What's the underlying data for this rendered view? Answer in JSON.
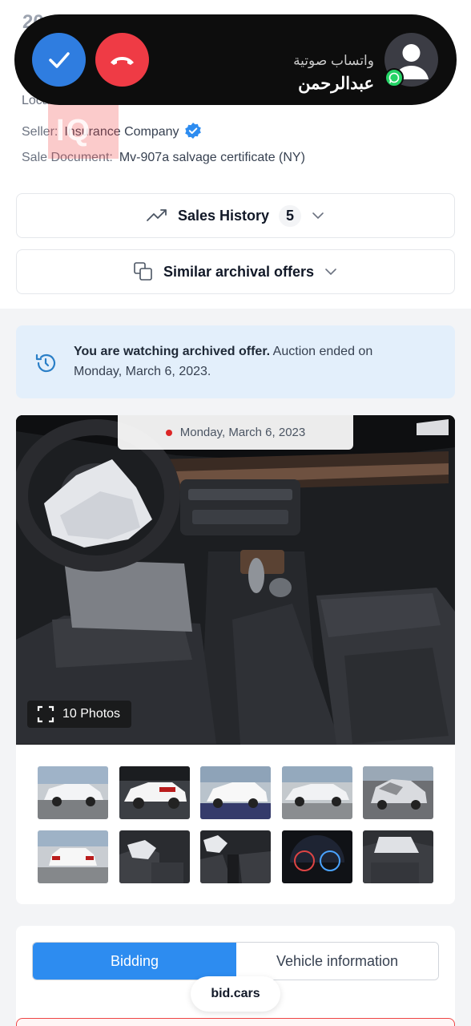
{
  "page": {
    "title_peek": "20",
    "location_label": "Location:",
    "seller_label": "Seller:",
    "seller_value": "Insurance Company",
    "sale_document_label": "Sale Document:",
    "sale_document_value": "Mv-907a salvage certificate (NY)"
  },
  "watermark": {
    "text": "IQ"
  },
  "incoming_call": {
    "caller_subtitle": "واتساب صوتية",
    "caller_name": "عبدالرحمن",
    "accept_icon": "checkmark-icon",
    "decline_icon": "phone-hangup-icon",
    "colors": {
      "bar": "#0d0d0d",
      "accept": "#2f7de0",
      "decline": "#ef3b45",
      "whatsapp": "#25d366"
    }
  },
  "sales_history": {
    "label": "Sales History",
    "count": "5",
    "icon": "trending-up-icon"
  },
  "similar_offers": {
    "label": "Similar archival offers",
    "icon": "copy-icon"
  },
  "notice": {
    "bold": "You are watching archived offer.",
    "text": " Auction ended on Monday, March 6, 2023.",
    "icon": "history-icon",
    "background": "#e3effb"
  },
  "gallery": {
    "date": "Monday, March 6, 2023",
    "photos_label": "10 Photos",
    "photos_icon": "fullscreen-icon",
    "thumbnails": [
      "exterior-front-left",
      "exterior-rear-left",
      "exterior-rear-right",
      "exterior-side-right",
      "exterior-front-damage",
      "exterior-rear",
      "interior-airbag-driver",
      "interior-front-seats",
      "instrument-cluster",
      "interior-rear-seats"
    ]
  },
  "tabs": {
    "bidding": "Bidding",
    "vehicle_information": "Vehicle information",
    "active_color": "#2d8cf0"
  },
  "browser": {
    "site": "bid.cars"
  }
}
